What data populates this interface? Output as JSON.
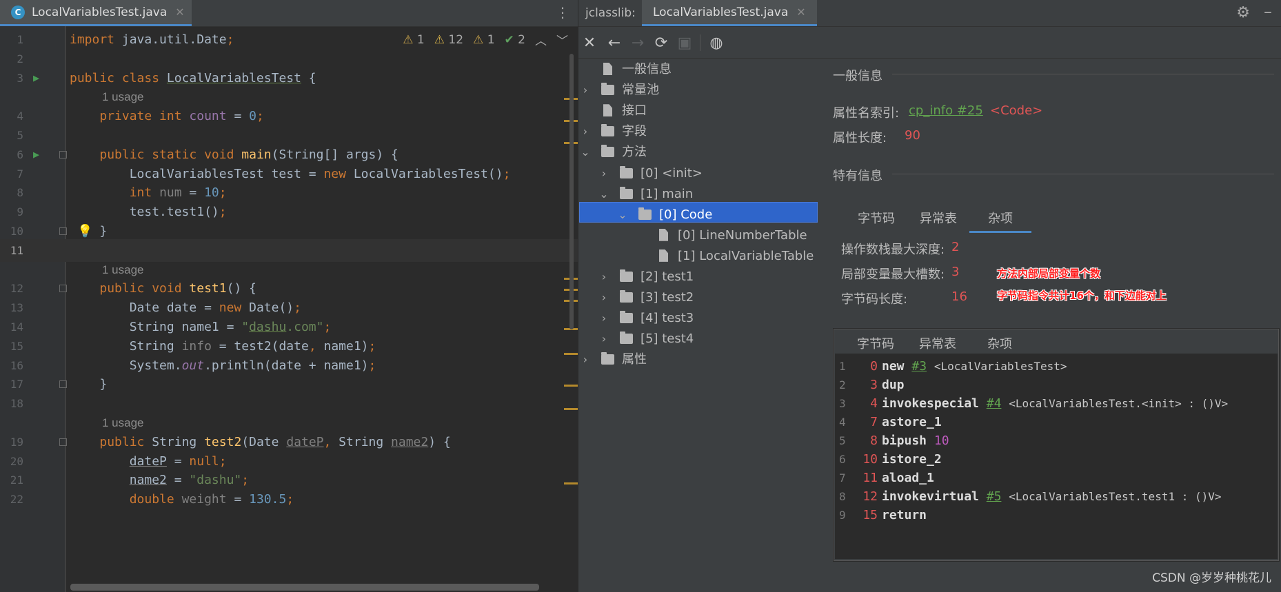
{
  "editor": {
    "tab_label": "LocalVariablesTest.java",
    "tab_icon": "C",
    "inspections": {
      "warn_a": "1",
      "warn_b": "12",
      "warn_c": "1",
      "ok": "2"
    },
    "lines": [
      {
        "num": "1",
        "html": "<span class=\"kw\">import</span> java.util.Date<span class=\"kw\">;</span>"
      },
      {
        "num": "2",
        "html": ""
      },
      {
        "num": "3",
        "html": "<span class=\"kw\">public class</span> <span class=\"ul\">LocalVariablesTest</span> {"
      },
      {
        "usage": "1 usage"
      },
      {
        "num": "4",
        "html": "    <span class=\"kw\">private int</span> <span class=\"static\" style=\"font-style:normal;color:#9876aa\">count</span> = <span class=\"num\">0</span><span class=\"kw\">;</span>"
      },
      {
        "num": "5",
        "html": ""
      },
      {
        "num": "6",
        "html": "    <span class=\"kw\">public static void</span> <span class=\"fn\">main</span>(String[] args) {"
      },
      {
        "num": "7",
        "html": "        LocalVariablesTest test = <span class=\"kw\">new</span> LocalVariablesTest()<span class=\"kw\">;</span>"
      },
      {
        "num": "8",
        "html": "        <span class=\"kw\">int</span> <span class=\"gray\">num</span> = <span class=\"num\">10</span><span class=\"kw\">;</span>"
      },
      {
        "num": "9",
        "html": "        test.test1()<span class=\"kw\">;</span>"
      },
      {
        "num": "10",
        "html": "    }"
      },
      {
        "num": "11",
        "html": "",
        "current": true
      },
      {
        "usage": "1 usage"
      },
      {
        "num": "12",
        "html": "    <span class=\"kw\">public void</span> <span class=\"fn\">test1</span>() {"
      },
      {
        "num": "13",
        "html": "        Date date = <span class=\"kw\">new</span> Date()<span class=\"kw\">;</span>"
      },
      {
        "num": "14",
        "html": "        String name1 = <span class=\"str\">\"<span class=\"ul\">dashu</span>.com\"</span><span class=\"kw\">;</span>"
      },
      {
        "num": "15",
        "html": "        String <span class=\"gray\">info</span> = test2(date<span class=\"kw\">,</span> name1)<span class=\"kw\">;</span>"
      },
      {
        "num": "16",
        "html": "        System.<span class=\"static\">out</span>.println(date + name1)<span class=\"kw\">;</span>"
      },
      {
        "num": "17",
        "html": "    }"
      },
      {
        "num": "18",
        "html": ""
      },
      {
        "usage": "1 usage"
      },
      {
        "num": "19",
        "html": "    <span class=\"kw\">public</span> String <span class=\"fn\">test2</span>(Date <span class=\"gray ulg\">dateP</span><span class=\"kw\">,</span> String <span class=\"gray ulg\">name2</span>) {"
      },
      {
        "num": "20",
        "html": "        <span class=\"ulg\">dateP</span> = <span class=\"kw\">null;</span>"
      },
      {
        "num": "21",
        "html": "        <span class=\"ulg\">name2</span> = <span class=\"str\">\"dashu\"</span><span class=\"kw\">;</span>"
      },
      {
        "num": "22",
        "html": "        <span class=\"kw\">double</span> <span class=\"gray\">weight</span> = <span class=\"num\">130.5</span><span class=\"kw\">;</span>"
      }
    ]
  },
  "jclasslib": {
    "label": "jclasslib:",
    "tab_label": "LocalVariablesTest.java",
    "tree": [
      {
        "label": "一般信息",
        "icon": "file",
        "depth": 0,
        "arrow": ""
      },
      {
        "label": "常量池",
        "icon": "folder",
        "depth": 0,
        "arrow": ">"
      },
      {
        "label": "接口",
        "icon": "file",
        "depth": 0,
        "arrow": ""
      },
      {
        "label": "字段",
        "icon": "folder",
        "depth": 0,
        "arrow": ">"
      },
      {
        "label": "方法",
        "icon": "folder",
        "depth": 0,
        "arrow": "v"
      },
      {
        "label": "[0] <init>",
        "icon": "folder",
        "depth": 1,
        "arrow": ">"
      },
      {
        "label": "[1] main",
        "icon": "folder",
        "depth": 1,
        "arrow": "v"
      },
      {
        "label": "[0] Code",
        "icon": "folder",
        "depth": 2,
        "arrow": "v",
        "selected": true
      },
      {
        "label": "[0] LineNumberTable",
        "icon": "file",
        "depth": 3,
        "arrow": ""
      },
      {
        "label": "[1] LocalVariableTable",
        "icon": "file",
        "depth": 3,
        "arrow": ""
      },
      {
        "label": "[2] test1",
        "icon": "folder",
        "depth": 1,
        "arrow": ">"
      },
      {
        "label": "[3] test2",
        "icon": "folder",
        "depth": 1,
        "arrow": ">"
      },
      {
        "label": "[4] test3",
        "icon": "folder",
        "depth": 1,
        "arrow": ">"
      },
      {
        "label": "[5] test4",
        "icon": "folder",
        "depth": 1,
        "arrow": ">"
      },
      {
        "label": "属性",
        "icon": "folder",
        "depth": 0,
        "arrow": ">"
      }
    ],
    "general": {
      "title": "一般信息",
      "name_index_label": "属性名索引:",
      "name_index_link": "cp_info #25",
      "name_index_value": "<Code>",
      "length_label": "属性长度:",
      "length_value": "90"
    },
    "specific": {
      "title": "特有信息",
      "tabs": [
        "字节码",
        "异常表",
        "杂项"
      ],
      "active_tab": 2,
      "max_stack_label": "操作数栈最大深度:",
      "max_stack_value": "2",
      "max_locals_label": "局部变量最大槽数:",
      "max_locals_value": "3",
      "code_length_label": "字节码长度:",
      "code_length_value": "16",
      "annotation_1": "方法内部局部变量个数",
      "annotation_2": "字节码指令共计16个，和下边能对上"
    },
    "bytecode": {
      "tabs": [
        "字节码",
        "异常表",
        "杂项"
      ],
      "active_tab": 0,
      "lines": [
        {
          "ln": "1",
          "off": "0",
          "op": "new",
          "ref": "#3",
          "args": "<LocalVariablesTest>"
        },
        {
          "ln": "2",
          "off": "3",
          "op": "dup",
          "ref": "",
          "args": ""
        },
        {
          "ln": "3",
          "off": "4",
          "op": "invokespecial",
          "ref": "#4",
          "args": "<LocalVariablesTest.<init> : ()V>"
        },
        {
          "ln": "4",
          "off": "7",
          "op": "astore_1",
          "ref": "",
          "args": ""
        },
        {
          "ln": "5",
          "off": "8",
          "op": "bipush",
          "ref": "",
          "args": "",
          "imm": "10"
        },
        {
          "ln": "6",
          "off": "10",
          "op": "istore_2",
          "ref": "",
          "args": ""
        },
        {
          "ln": "7",
          "off": "11",
          "op": "aload_1",
          "ref": "",
          "args": ""
        },
        {
          "ln": "8",
          "off": "12",
          "op": "invokevirtual",
          "ref": "#5",
          "args": "<LocalVariablesTest.test1 : ()V>"
        },
        {
          "ln": "9",
          "off": "15",
          "op": "return",
          "ref": "",
          "args": ""
        }
      ]
    }
  },
  "watermark": "CSDN @岁岁种桃花儿"
}
